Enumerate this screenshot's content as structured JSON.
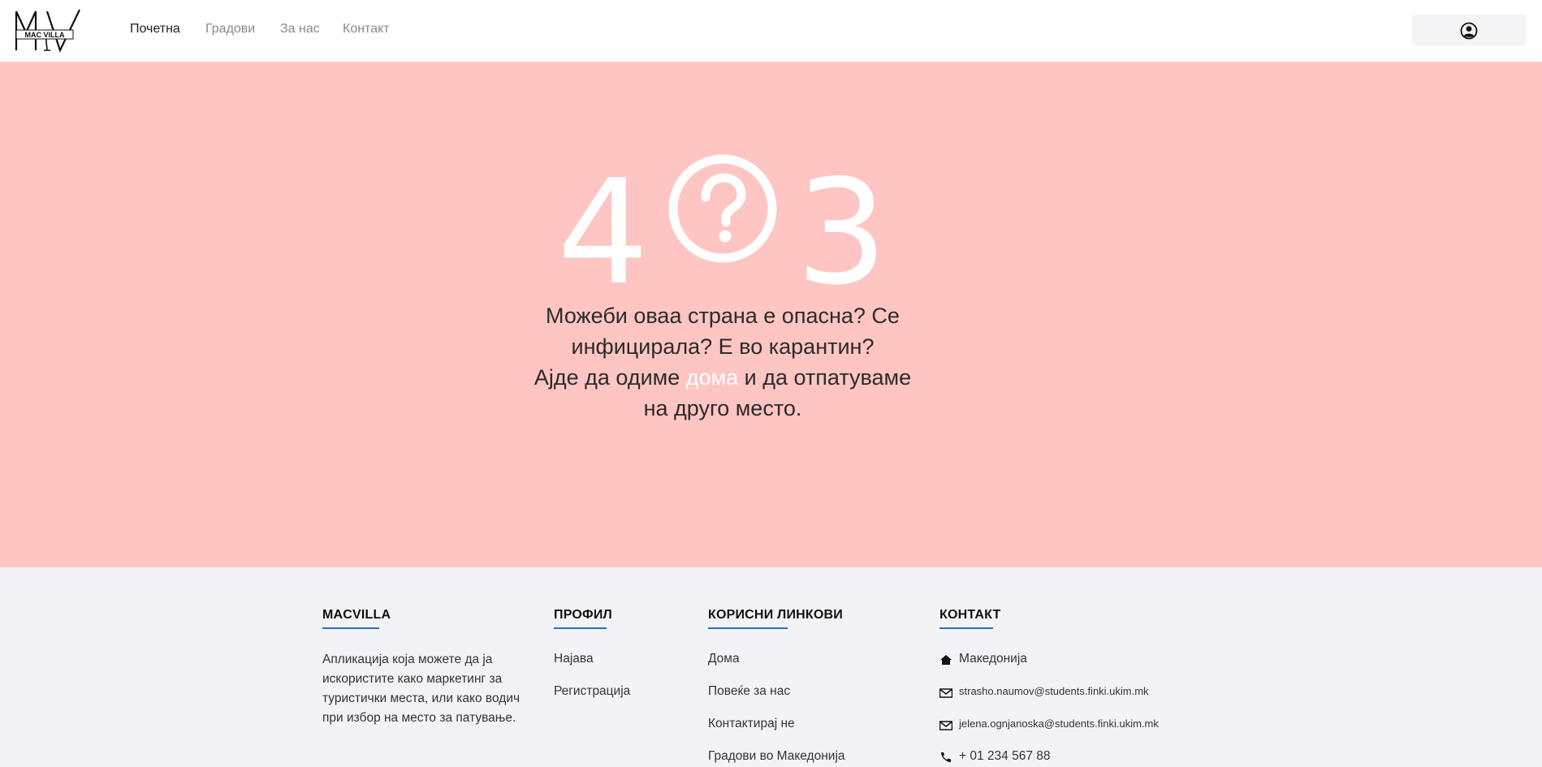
{
  "brand": {
    "logo_text": "MAC VILLA",
    "logo_initials": "MV"
  },
  "nav": {
    "items": [
      {
        "label": "Почетна",
        "active": true
      },
      {
        "label": "Градови",
        "active": false
      },
      {
        "label": "За нас",
        "active": false
      },
      {
        "label": "Контакт",
        "active": false
      }
    ],
    "account_icon": "user-circle-icon"
  },
  "hero": {
    "background": "#fec5c3",
    "code_first": "4",
    "code_last": "3",
    "code_middle_icon": "question-circle-icon",
    "message_line1": "Можеби оваа страна е опасна? Се",
    "message_line2": "инфицирала? Е во карантин?",
    "message_line3_before": "Ајде да одиме",
    "message_link": "дома",
    "message_line3_after": "и да отпатуваме",
    "message_line4": "на друго место."
  },
  "footer": {
    "col1": {
      "title": "MACVILLA",
      "text": "Апликација која можете да ја искористите како маркетинг за туристички места, или како водич при избор на место за патување."
    },
    "col2": {
      "title": "ПРОФИЛ",
      "links": [
        "Најава",
        "Регистрација"
      ]
    },
    "col3": {
      "title": "КОРИСНИ ЛИНКОВИ",
      "links": [
        "Дома",
        "Повеќе за нас",
        "Контактирај не",
        "Градови во Македонија"
      ]
    },
    "col4": {
      "title": "КОНТАКТ",
      "location": "Македонија",
      "email1": "strasho.naumov@students.finki.ukim.mk",
      "email2": "jelena.ognjanoska@students.finki.ukim.mk",
      "phone": "+ 01 234 567 88",
      "icons": [
        "home-icon",
        "envelope-icon",
        "envelope-icon",
        "phone-icon"
      ]
    },
    "accent": "#2a6ebb"
  }
}
